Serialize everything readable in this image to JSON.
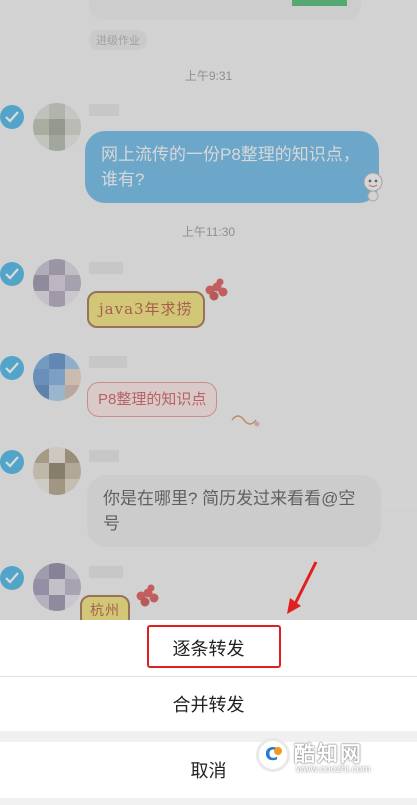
{
  "chat": {
    "tag_label": "进级作业",
    "timestamps": [
      "上午9:31",
      "上午11:30"
    ],
    "messages": [
      {
        "text": "网上流传的一份P8整理的知识点，谁有?"
      },
      {
        "text": "java3年求捞"
      },
      {
        "text": "P8整理的知识点"
      },
      {
        "text": "你是在哪里? 简历发过来看看@空号"
      },
      {
        "text": "杭州"
      }
    ]
  },
  "sheet": {
    "forward_one_by_one": "逐条转发",
    "merge_forward": "合并转发",
    "cancel": "取消"
  },
  "watermark": {
    "logo_letter": "C",
    "name": "酷知网",
    "url": "www.coozhi.com"
  },
  "colors": {
    "check_blue": "#14a1e0",
    "bubble_blue": "#41a5e0",
    "highlight_red": "#e02020"
  }
}
